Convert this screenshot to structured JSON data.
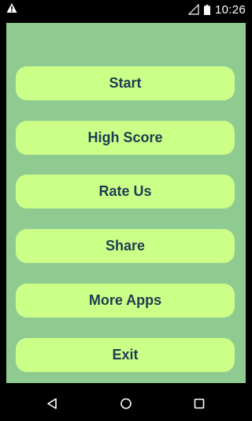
{
  "status_bar": {
    "time": "10:26",
    "icons": [
      "warning-icon",
      "signal-icon",
      "battery-icon"
    ]
  },
  "menu": {
    "background_color": "#8fcb91",
    "button_color": "#ccff88",
    "text_color": "#1f3b52",
    "buttons": [
      {
        "label": "Start"
      },
      {
        "label": "High Score"
      },
      {
        "label": "Rate Us"
      },
      {
        "label": "Share"
      },
      {
        "label": "More Apps"
      },
      {
        "label": "Exit"
      }
    ]
  },
  "nav_bar": {
    "icons": [
      "back-icon",
      "home-icon",
      "recents-icon"
    ]
  }
}
